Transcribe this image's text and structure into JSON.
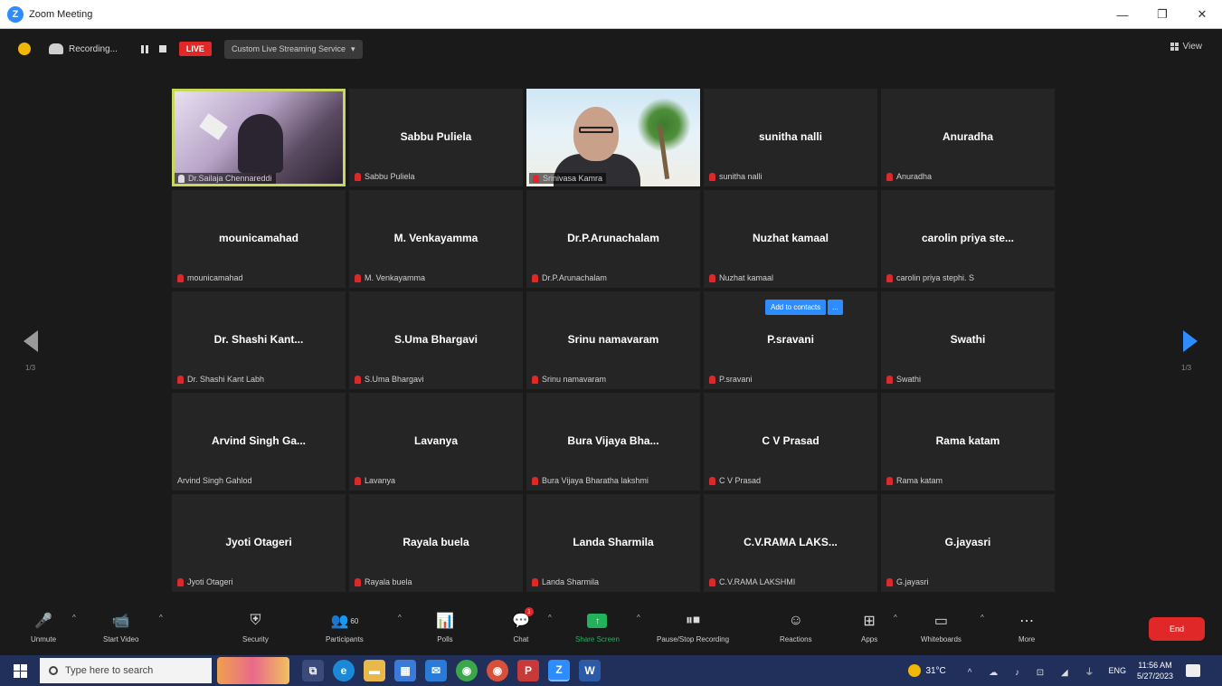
{
  "window": {
    "title": "Zoom Meeting",
    "minimize": "—",
    "restore": "❐",
    "close": "✕"
  },
  "topbar": {
    "recording_label": "Recording...",
    "live_badge": "LIVE",
    "stream_service": "Custom Live Streaming Service",
    "stream_caret": "▾",
    "view_label": "View"
  },
  "participants": [
    {
      "name": "",
      "label": "Dr.Sailaja Chennareddi",
      "muted": false,
      "video": "room",
      "active": true
    },
    {
      "name": "Sabbu Puliela",
      "label": "Sabbu Puliela",
      "muted": true
    },
    {
      "name": "",
      "label": "Srinivasa Kamra",
      "muted": true,
      "video": "beach"
    },
    {
      "name": "sunitha nalli",
      "label": "sunitha nalli",
      "muted": true
    },
    {
      "name": "Anuradha",
      "label": "Anuradha",
      "muted": true
    },
    {
      "name": "mounicamahad",
      "label": "mounicamahad",
      "muted": true
    },
    {
      "name": "M. Venkayamma",
      "label": "M. Venkayamma",
      "muted": true
    },
    {
      "name": "Dr.P.Arunachalam",
      "label": "Dr.P.Arunachalam",
      "muted": true
    },
    {
      "name": "Nuzhat kamaal",
      "label": "Nuzhat kamaal",
      "muted": true
    },
    {
      "name": "carolin priya ste...",
      "label": "carolin priya stephi. S",
      "muted": true
    },
    {
      "name": "Dr. Shashi Kant...",
      "label": "Dr. Shashi Kant Labh",
      "muted": true
    },
    {
      "name": "S.Uma Bhargavi",
      "label": "S.Uma Bhargavi",
      "muted": true
    },
    {
      "name": "Srinu namavaram",
      "label": "Srinu namavaram",
      "muted": true
    },
    {
      "name": "P.sravani",
      "label": "P.sravani",
      "muted": true
    },
    {
      "name": "Swathi",
      "label": "Swathi",
      "muted": true
    },
    {
      "name": "Arvind Singh Ga...",
      "label": "Arvind Singh Gahlod",
      "muted": false
    },
    {
      "name": "Lavanya",
      "label": "Lavanya",
      "muted": true
    },
    {
      "name": "Bura Vijaya Bha...",
      "label": "Bura Vijaya Bharatha lakshmi",
      "muted": true
    },
    {
      "name": "C V Prasad",
      "label": "C V Prasad",
      "muted": true
    },
    {
      "name": "Rama katam",
      "label": "Rama katam",
      "muted": true
    },
    {
      "name": "Jyoti Otageri",
      "label": "Jyoti Otageri",
      "muted": true
    },
    {
      "name": "Rayala buela",
      "label": "Rayala buela",
      "muted": true
    },
    {
      "name": "Landa Sharmila",
      "label": "Landa Sharmila",
      "muted": true
    },
    {
      "name": "C.V.RAMA LAKS...",
      "label": "C.V.RAMA LAKSHMI",
      "muted": true
    },
    {
      "name": "G.jayasri",
      "label": "G.jayasri",
      "muted": true
    }
  ],
  "popup": {
    "add_contacts": "Add to contacts",
    "more": "..."
  },
  "pagination": {
    "left": "1/3",
    "right": "1/3"
  },
  "toolbar": {
    "unmute": "Unmute",
    "start_video": "Start Video",
    "security": "Security",
    "participants": "Participants",
    "participants_count": "60",
    "polls": "Polls",
    "chat": "Chat",
    "chat_badge": "1",
    "share_screen": "Share Screen",
    "pause_recording": "Pause/Stop Recording",
    "reactions": "Reactions",
    "apps": "Apps",
    "whiteboards": "Whiteboards",
    "more": "More",
    "end": "End",
    "caret": "^"
  },
  "taskbar": {
    "search_placeholder": "Type here to search",
    "temperature": "31°C",
    "tray": "^ ☁ ♪ ⊡ ◢ ⏚",
    "language": "ENG",
    "time": "11:56 AM",
    "date": "5/27/2023"
  },
  "colors": {
    "accent": "#2d8cff",
    "danger": "#e02828",
    "active_speaker": "#c7d85a",
    "share_green": "#21b25a"
  }
}
